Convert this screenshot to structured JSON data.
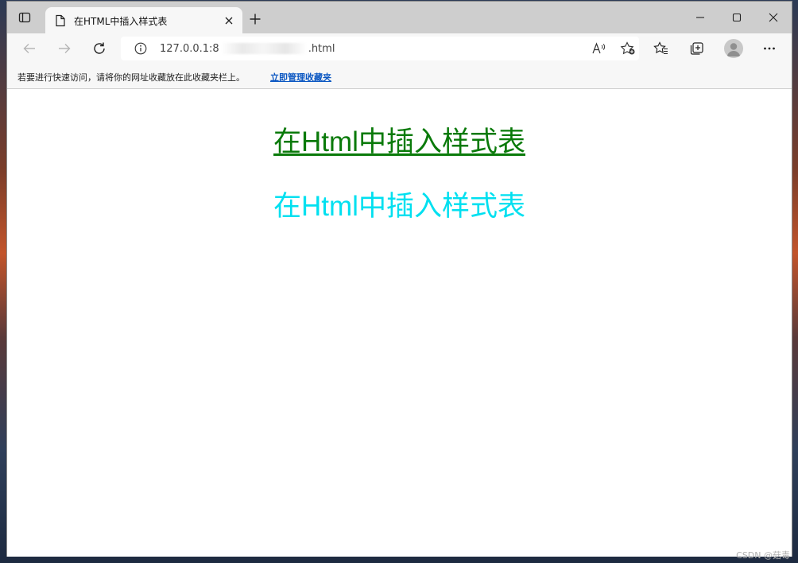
{
  "tab": {
    "title": "在HTML中插入样式表"
  },
  "address": {
    "url_prefix": "127.0.0.1:8",
    "url_suffix": ".html"
  },
  "favorites_bar": {
    "prompt": "若要进行快速访问，请将你的网址收藏放在此收藏夹栏上。",
    "manage_link": "立即管理收藏夹"
  },
  "page": {
    "heading_green": "在Html中插入样式表",
    "heading_cyan": "在Html中插入样式表"
  },
  "watermark": "CSDN @菇毒",
  "colors": {
    "heading_green": "#0a7a0a",
    "heading_cyan": "#00e0f0",
    "link": "#0b57c2"
  },
  "icons": [
    "tab-actions-icon",
    "page-icon",
    "close-icon",
    "plus-icon",
    "minimize-icon",
    "maximize-icon",
    "close-window-icon",
    "back-icon",
    "forward-icon",
    "refresh-icon",
    "info-icon",
    "read-aloud-icon",
    "add-favorite-icon",
    "favorites-icon",
    "collections-icon",
    "profile-icon",
    "more-icon"
  ]
}
